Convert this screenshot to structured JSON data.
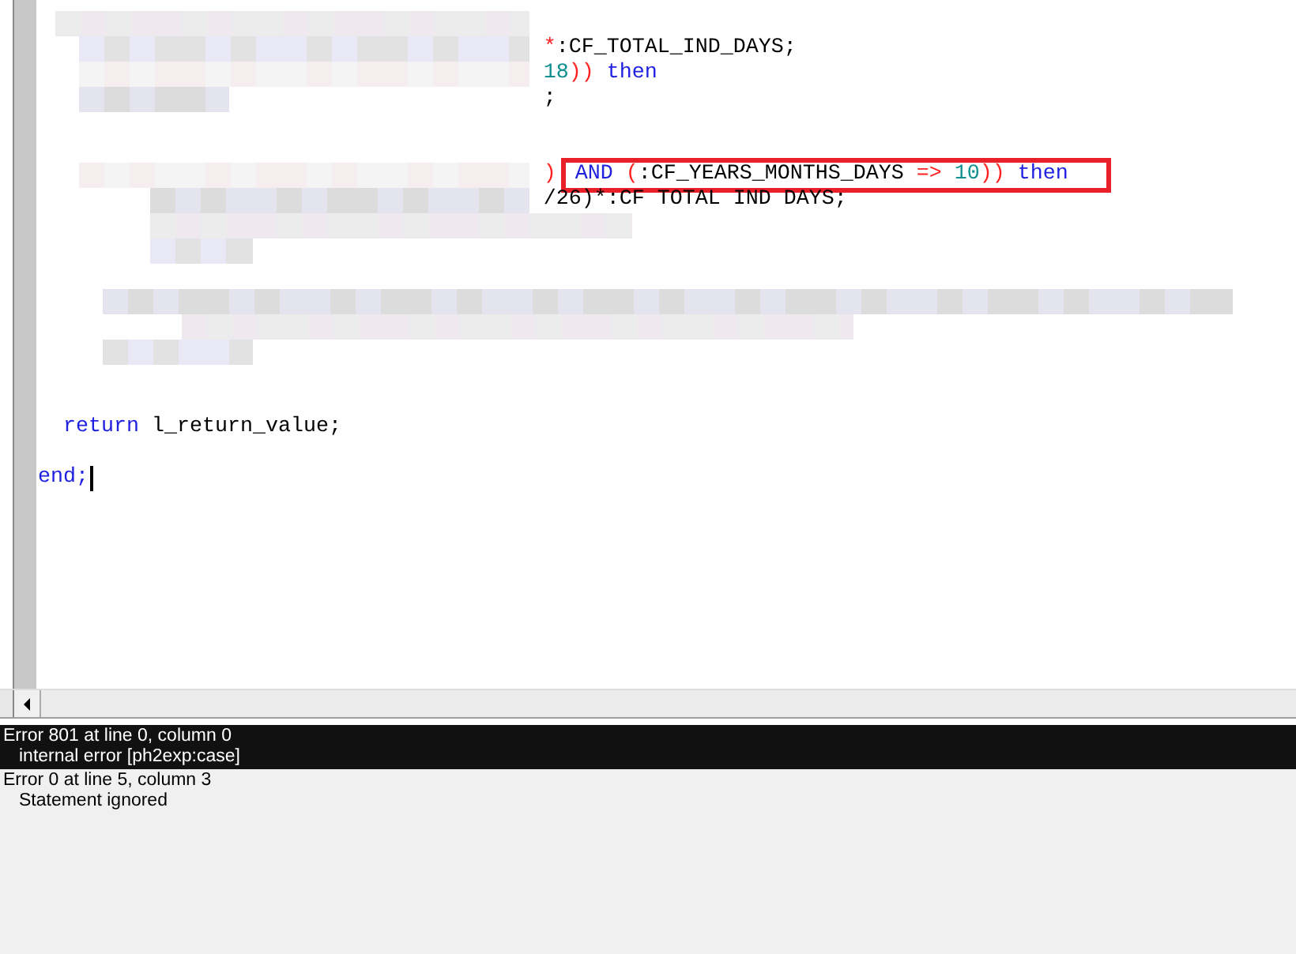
{
  "editor": {
    "lines": [
      {
        "redacted": true
      },
      {
        "redacted": true,
        "tokens": [
          {
            "text": "*",
            "kind": "op"
          },
          {
            "text": ":CF_TOTAL_IND_DAYS;",
            "kind": "plain"
          }
        ]
      },
      {
        "redacted": true,
        "tokens": [
          {
            "text": "18",
            "kind": "num"
          },
          {
            "text": "))",
            "kind": "op"
          },
          {
            "text": " then",
            "kind": "kw"
          }
        ]
      },
      {
        "redacted": true,
        "tokens": [
          {
            "text": ";",
            "kind": "plain"
          }
        ]
      },
      {
        "redacted": false
      },
      {
        "redacted": false
      },
      {
        "redacted": true,
        "tokens": [
          {
            "text": ")",
            "kind": "op"
          }
        ],
        "boxed": [
          {
            "text": "AND",
            "kind": "kw"
          },
          {
            "text": " (",
            "kind": "op"
          },
          {
            "text": ":CF_YEARS_MONTHS_DAYS",
            "kind": "plain"
          },
          {
            "text": " =>",
            "kind": "op"
          },
          {
            "text": " 10",
            "kind": "num"
          },
          {
            "text": "))",
            "kind": "op"
          },
          {
            "text": " then",
            "kind": "kw"
          }
        ]
      },
      {
        "redacted": true,
        "tokens": [
          {
            "text": "/26)*:CF TOTAL IND DAYS;",
            "kind": "plain"
          }
        ]
      },
      {
        "redacted": true
      },
      {
        "redacted": true
      },
      {
        "redacted": false
      },
      {
        "redacted": true
      },
      {
        "redacted": true
      },
      {
        "redacted": true
      },
      {
        "redacted": false
      },
      {
        "redacted": false
      },
      {
        "redacted": false,
        "tokens": [
          {
            "text": "  return",
            "kind": "kw"
          },
          {
            "text": " l_return_value;",
            "kind": "plain"
          }
        ]
      },
      {
        "redacted": false
      },
      {
        "redacted": false,
        "tokens": [
          {
            "text": "end;",
            "kind": "kw"
          }
        ],
        "cursor": true
      }
    ]
  },
  "messages": [
    {
      "title": "Error 801 at line 0, column 0",
      "detail": "internal error [ph2exp:case]",
      "selected": true
    },
    {
      "title": "Error 0 at line 5, column 3",
      "detail": "Statement ignored",
      "selected": false
    }
  ]
}
